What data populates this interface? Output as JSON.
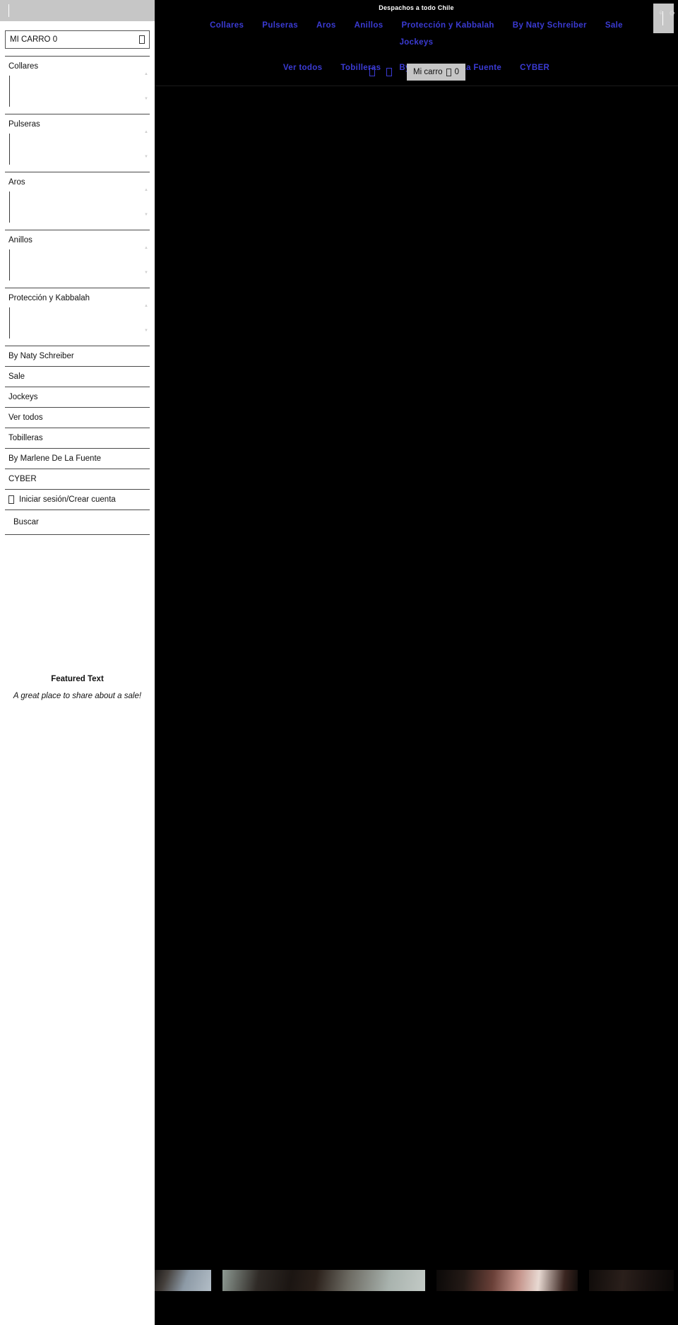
{
  "site": {
    "announcement": "Despachos a todo Chile",
    "nav_row_1": [
      {
        "label": "Collares"
      },
      {
        "label": "Pulseras"
      },
      {
        "label": "Aros"
      },
      {
        "label": "Anillos"
      },
      {
        "label": "Protección y Kabbalah"
      },
      {
        "label": "By Naty Schreiber"
      },
      {
        "label": "Sale"
      },
      {
        "label": "Jockeys"
      }
    ],
    "nav_row_2": [
      {
        "label": "Ver todos"
      },
      {
        "label": "Tobilleras"
      },
      {
        "label": "By Marlene De La Fuente"
      },
      {
        "label": "CYBER"
      }
    ],
    "utility": {
      "search_icon": "search-icon",
      "account_icon": "account-icon",
      "cart_label": "Mi carro",
      "cart_icon": "shopping-bag-icon",
      "cart_count": "0"
    },
    "corner_glyphs": "⚘ ⚙",
    "accent_link_color": "#3b3bd4",
    "background_color": "#000000"
  },
  "panel": {
    "topbar_caret": "text-cursor",
    "cart_field": {
      "label": "MI CARRO 0",
      "icon": "shopping-bag-icon"
    },
    "menu_items": [
      {
        "label": "Collares",
        "expandable": true
      },
      {
        "label": "Pulseras",
        "expandable": true
      },
      {
        "label": "Aros",
        "expandable": true
      },
      {
        "label": "Anillos",
        "expandable": true
      },
      {
        "label": "Protección y Kabbalah",
        "expandable": true
      },
      {
        "label": "By Naty Schreiber",
        "expandable": false
      },
      {
        "label": "Sale",
        "expandable": false
      },
      {
        "label": "Jockeys",
        "expandable": false
      },
      {
        "label": "Ver todos",
        "expandable": false
      },
      {
        "label": "Tobilleras",
        "expandable": false
      },
      {
        "label": "By Marlene De La Fuente",
        "expandable": false
      },
      {
        "label": "CYBER",
        "expandable": false
      }
    ],
    "account": {
      "label": "Iniciar sesión/Crear cuenta",
      "icon": "user-icon"
    },
    "search": {
      "label": "Buscar",
      "icon": "search-icon"
    },
    "featured": {
      "title": "Featured Text",
      "subtitle": "A great place to share about a sale!"
    }
  }
}
